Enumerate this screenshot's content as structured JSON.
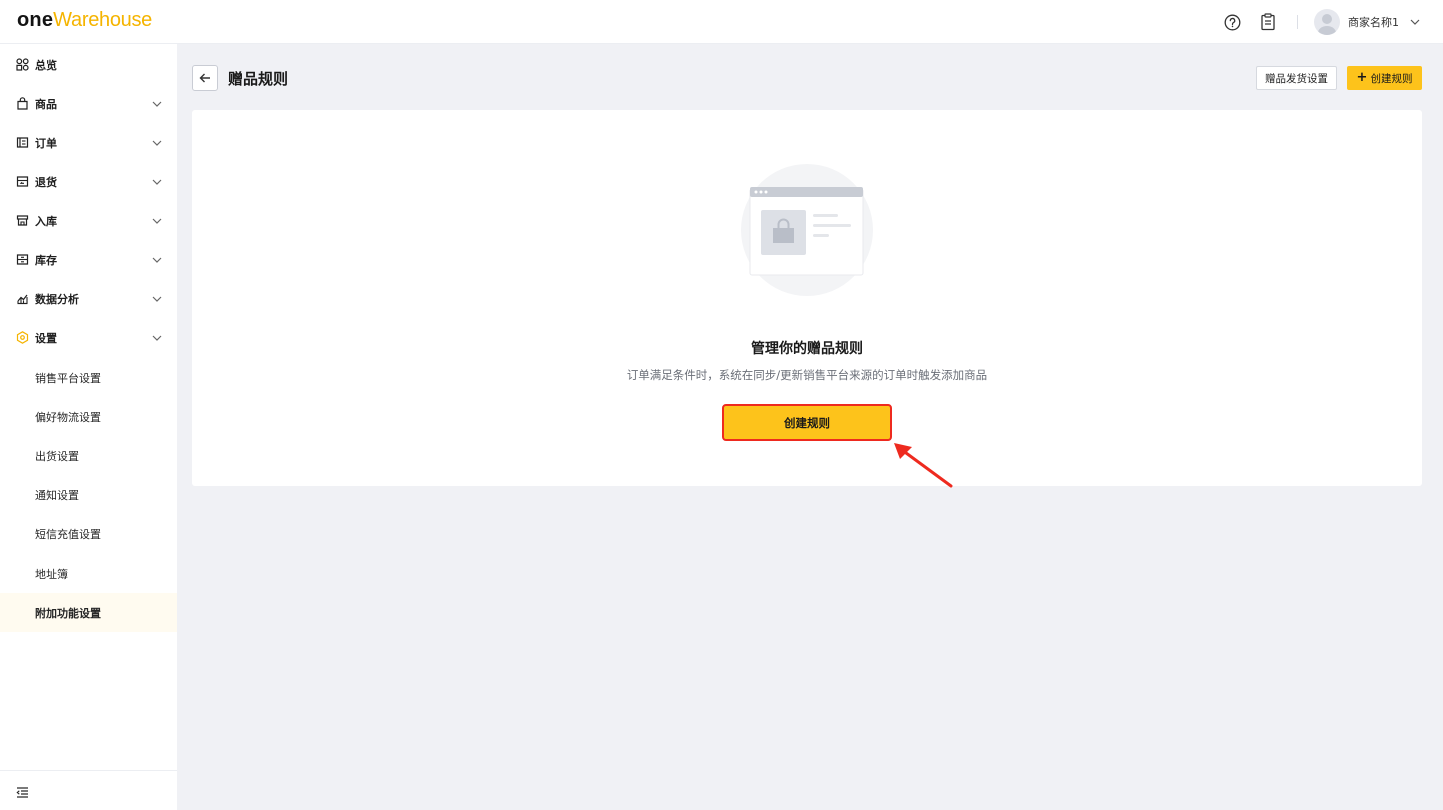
{
  "header": {
    "logo_one": "one",
    "logo_warehouse": "Warehouse",
    "merchant_name": "商家名称1",
    "icons": [
      "help-circle-icon",
      "clipboard-icon",
      "chevron-down-icon"
    ]
  },
  "sidebar": {
    "items": [
      {
        "label": "总览",
        "icon": "dashboard-icon"
      },
      {
        "label": "商品",
        "icon": "product-bag-icon"
      },
      {
        "label": "订单",
        "icon": "order-icon"
      },
      {
        "label": "退货",
        "icon": "return-icon"
      },
      {
        "label": "入库",
        "icon": "inbound-icon"
      },
      {
        "label": "库存",
        "icon": "inventory-icon"
      },
      {
        "label": "数据分析",
        "icon": "analytics-icon"
      },
      {
        "label": "设置",
        "icon": "settings-icon"
      }
    ],
    "sub_items": [
      {
        "label": "销售平台设置"
      },
      {
        "label": "偏好物流设置"
      },
      {
        "label": "出货设置"
      },
      {
        "label": "通知设置"
      },
      {
        "label": "短信充值设置"
      },
      {
        "label": "地址簿"
      },
      {
        "label": "附加功能设置",
        "active": true
      }
    ]
  },
  "page": {
    "title": "赠品规则",
    "shipping_settings_label": "赠品发货设置",
    "create_rule_label": "创建规则",
    "create_rule_plus": "+"
  },
  "empty_state": {
    "title": "管理你的赠品规则",
    "description": "订单满足条件时，系统在同步/更新销售平台来源的订单时触发添加商品",
    "button_label": "创建规则"
  },
  "colors": {
    "accent": "#fdc31b",
    "highlight_border": "#ee2a1f",
    "active_bg": "#fffbf0",
    "page_bg": "#f0f1f5"
  }
}
